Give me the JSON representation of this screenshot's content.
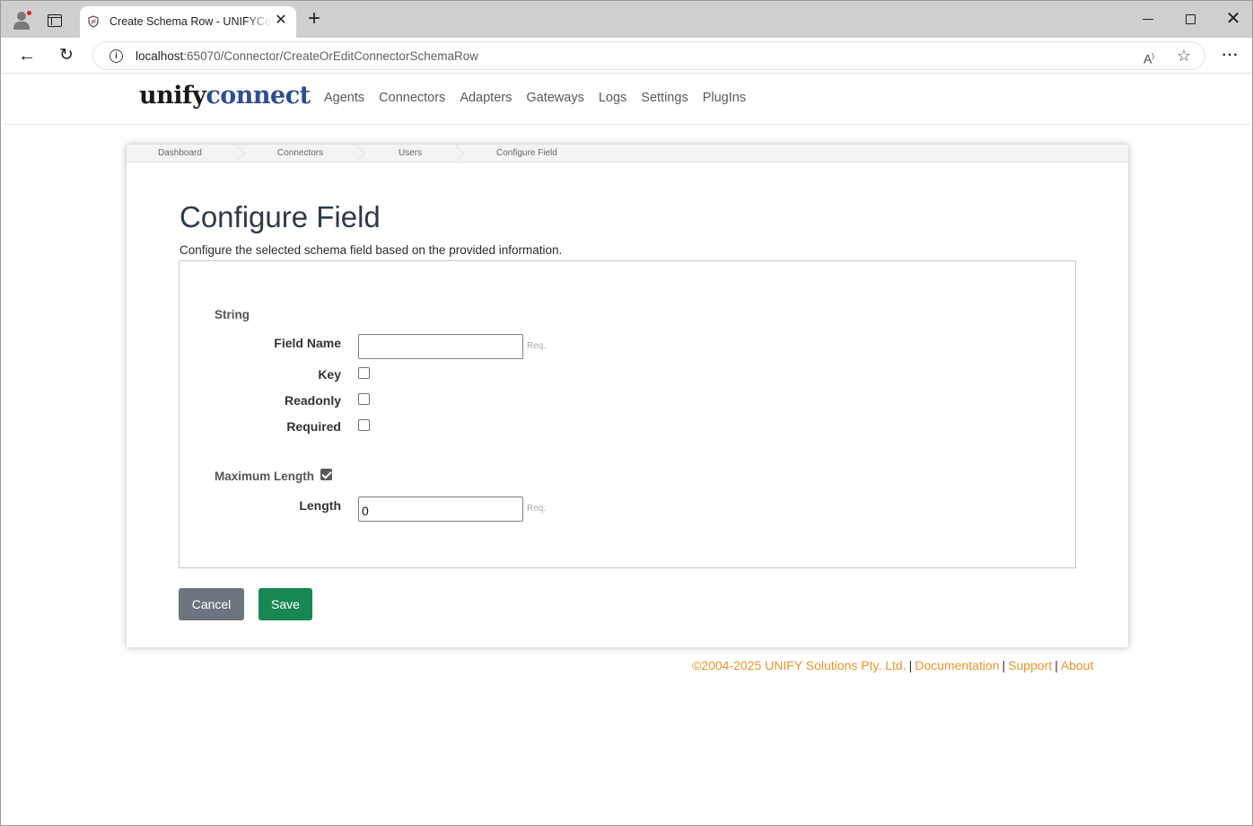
{
  "browser": {
    "tab_title": "Create Schema Row - UNIFYConnect",
    "url_host": "localhost",
    "url_path": ":65070/Connector/CreateOrEditConnectorSchemaRow"
  },
  "site": {
    "logo_part1": "unify",
    "logo_part2": "connect",
    "nav": [
      "Agents",
      "Connectors",
      "Adapters",
      "Gateways",
      "Logs",
      "Settings",
      "PlugIns"
    ]
  },
  "breadcrumbs": [
    "Dashboard",
    "Connectors",
    "Users",
    "Configure Field"
  ],
  "page": {
    "title": "Configure Field",
    "description": "Configure the selected schema field based on the provided information."
  },
  "form": {
    "type_label": "String",
    "field_name_label": "Field Name",
    "field_name_value": "",
    "req_hint": "Req.",
    "key_label": "Key",
    "key_checked": false,
    "readonly_label": "Readonly",
    "readonly_checked": false,
    "required_label": "Required",
    "required_checked": false,
    "max_length_label": "Maximum Length",
    "max_length_checked": true,
    "length_label": "Length",
    "length_value": "0"
  },
  "actions": {
    "cancel_label": "Cancel",
    "save_label": "Save"
  },
  "footer": {
    "copyright": "©2004-2025 UNIFY Solutions Pty. Ltd.",
    "documentation": "Documentation",
    "support": "Support",
    "about": "About",
    "separator": "|"
  },
  "colors": {
    "brand_blue": "#2f4d8f",
    "footer_link": "#e8952b",
    "save_button": "#198754",
    "cancel_button": "#6c757d"
  }
}
